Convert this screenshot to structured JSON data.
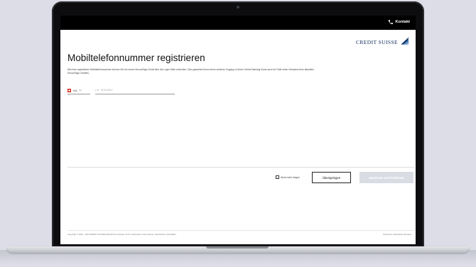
{
  "header": {
    "contact_label": "Kontakt",
    "contact_icon": "phone-icon"
  },
  "brand": {
    "name": "CREDIT SUISSE",
    "color": "#0b2a5b"
  },
  "page": {
    "title": "Mobiltelefonnummer registrieren",
    "description": "Mit einer registrierten Mobiltelefonnummer können Sie ein neues SecureSign-Gerät über die Login-Seite einrichten. Dies garantiert Ihnen einen sicheren Zugang zu Ihrem Online Banking Konto auch im Falle eines Verlustes Ihres aktuellen SecureSign-Gerätes."
  },
  "form": {
    "country_code": "+41",
    "country_flag": "switzerland-flag",
    "phone_value": "",
    "phone_placeholder": "z.B. 781234567"
  },
  "actions": {
    "dont_ask_label": "Nicht mehr fragen",
    "dont_ask_checked": false,
    "skip_label": "Überspringen",
    "primary_label": "Speichern und fortfahren"
  },
  "footer": {
    "copyright": "Copyright © 1997 - 2020 CREDIT SUISSE GROUP AG und/oder mit ihr verbundene Unternehmen. Alle Rechte vorbehalten.",
    "links": "Sicherheit / Rechtliche Hinweise"
  }
}
